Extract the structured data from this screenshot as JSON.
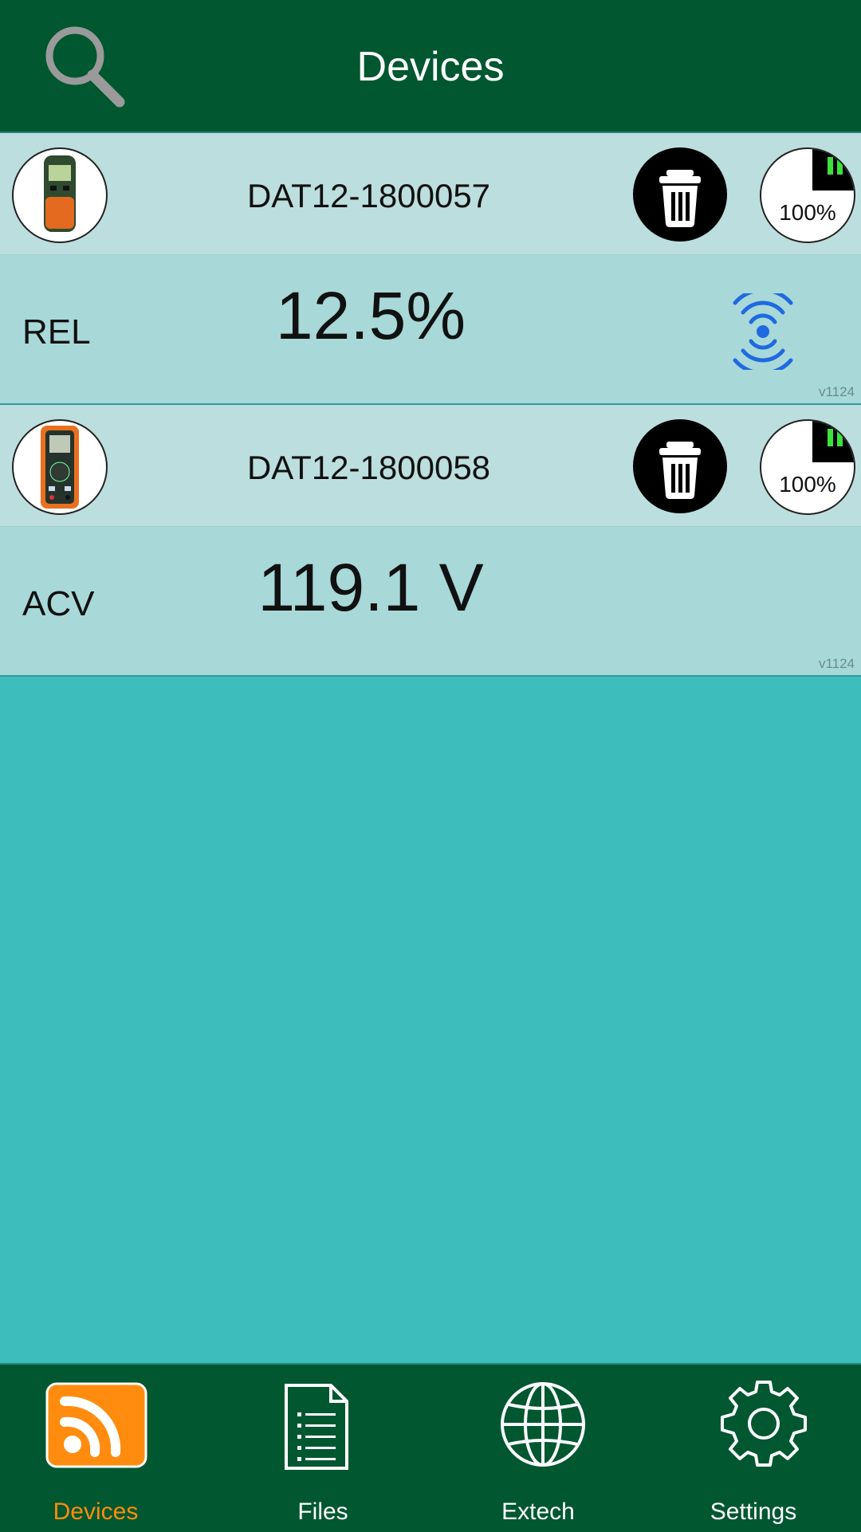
{
  "header": {
    "title": "Devices",
    "search_icon": "search-icon"
  },
  "devices": [
    {
      "name": "DAT12-1800057",
      "mode": "REL",
      "reading": "12.5%",
      "battery": "100%",
      "version": "v1124",
      "streaming": true
    },
    {
      "name": "DAT12-1800058",
      "mode": "ACV",
      "reading": "119.1 V",
      "battery": "100%",
      "version": "v1124",
      "streaming": false
    }
  ],
  "tabs": [
    {
      "label": "Devices",
      "icon": "rss-icon",
      "active": true
    },
    {
      "label": "Files",
      "icon": "document-list-icon",
      "active": false
    },
    {
      "label": "Extech",
      "icon": "globe-icon",
      "active": false
    },
    {
      "label": "Settings",
      "icon": "gear-icon",
      "active": false
    }
  ],
  "colors": {
    "header_bg": "#005730",
    "device_top_bg": "#bcdedf",
    "device_bottom_bg": "#a8d8d8",
    "page_bg": "#3dbdbb",
    "active_tab": "#ff8c0e",
    "wifi_icon": "#1f6ae0",
    "pause_icon": "#3be23b"
  }
}
